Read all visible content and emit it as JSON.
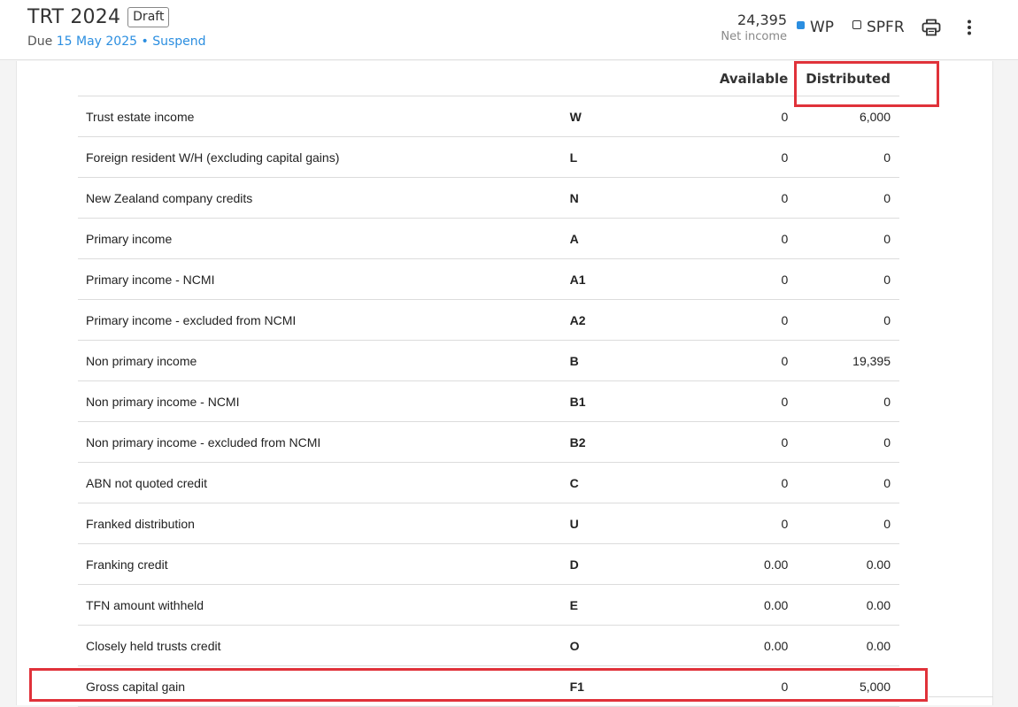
{
  "header": {
    "title": "TRT 2024",
    "status_badge": "Draft",
    "due_prefix": "Due",
    "due_date": "15 May 2025",
    "separator": "•",
    "suspend_label": "Suspend",
    "net_income_value": "24,395",
    "net_income_label": "Net income",
    "legend_wp": "WP",
    "legend_spfr": "SPFR",
    "legend_wp_color": "#2b8ee0",
    "print_icon": "printer-icon",
    "more_icon": "more-vertical-icon"
  },
  "table": {
    "columns": {
      "available": "Available",
      "distributed": "Distributed"
    },
    "rows": [
      {
        "label": "Trust estate income",
        "code": "W",
        "available": "0",
        "distributed": "6,000"
      },
      {
        "label": "Foreign resident W/H (excluding capital gains)",
        "code": "L",
        "available": "0",
        "distributed": "0"
      },
      {
        "label": "New Zealand company credits",
        "code": "N",
        "available": "0",
        "distributed": "0"
      },
      {
        "label": "Primary income",
        "code": "A",
        "available": "0",
        "distributed": "0"
      },
      {
        "label": "Primary income - NCMI",
        "code": "A1",
        "available": "0",
        "distributed": "0"
      },
      {
        "label": "Primary income - excluded from NCMI",
        "code": "A2",
        "available": "0",
        "distributed": "0"
      },
      {
        "label": "Non primary income",
        "code": "B",
        "available": "0",
        "distributed": "19,395"
      },
      {
        "label": "Non primary income - NCMI",
        "code": "B1",
        "available": "0",
        "distributed": "0"
      },
      {
        "label": "Non primary income - excluded from NCMI",
        "code": "B2",
        "available": "0",
        "distributed": "0"
      },
      {
        "label": "ABN not quoted credit",
        "code": "C",
        "available": "0",
        "distributed": "0"
      },
      {
        "label": "Franked distribution",
        "code": "U",
        "available": "0",
        "distributed": "0"
      },
      {
        "label": "Franking credit",
        "code": "D",
        "available": "0.00",
        "distributed": "0.00"
      },
      {
        "label": "TFN amount withheld",
        "code": "E",
        "available": "0.00",
        "distributed": "0.00"
      },
      {
        "label": "Closely held trusts credit",
        "code": "O",
        "available": "0.00",
        "distributed": "0.00"
      },
      {
        "label": "Gross capital gain",
        "code": "F1",
        "available": "0",
        "distributed": "5,000"
      }
    ]
  },
  "highlight_color": "#e0323a"
}
